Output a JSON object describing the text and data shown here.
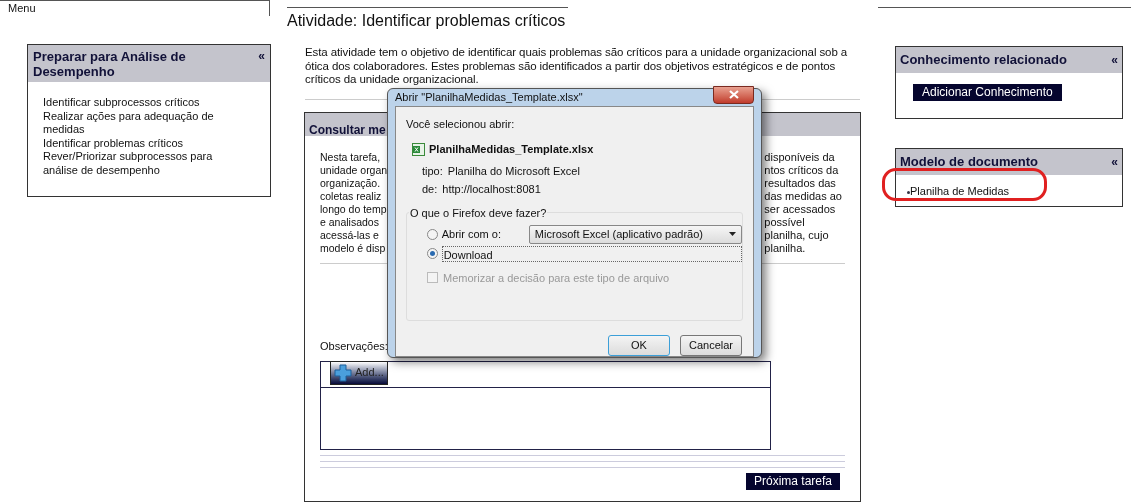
{
  "menu": {
    "label": "Menu"
  },
  "sidebar": {
    "title": "Preparar para Análise de Desempenho",
    "collapse": "«",
    "items": [
      "Identificar subprocessos críticos",
      "Realizar ações para adequação de medidas",
      "Identificar problemas críticos",
      "Rever/Priorizar subprocessos para análise de desempenho"
    ]
  },
  "activity": {
    "title": "Atividade: Identificar problemas críticos",
    "description": "Esta atividade tem o objetivo de identificar quais problemas são críticos para a unidade organizacional sob a ótica dos colaboradores. Estes problemas são identificados a partir dos objetivos estratégicos e de pontos críticos da unidade organizacional."
  },
  "task_panel": {
    "title": "Consultar me",
    "text_lines": [
      {
        "left": "Nesta tarefa,",
        "right": "disponíveis da"
      },
      {
        "left": "unidade organ",
        "right": "ntos críticos da"
      },
      {
        "left": "organização.",
        "right": "resultados das"
      },
      {
        "left": "coletas realiz",
        "right": "das medidas ao"
      },
      {
        "left": "longo do temp",
        "right": "ser acessados"
      },
      {
        "left": "e analisados",
        "right": "possível"
      },
      {
        "left": "acessá-las e",
        "right": "planilha, cujo"
      },
      {
        "left": "modelo é disp",
        "right": "planilha."
      }
    ],
    "observations_label": "Observações:",
    "add_button": "Add...",
    "next_button": "Próxima tarefa"
  },
  "related_knowledge": {
    "title": "Conhecimento relacionado",
    "collapse": "«",
    "button": "Adicionar Conhecimento"
  },
  "document_template": {
    "title": "Modelo de documento",
    "collapse": "«",
    "items": [
      {
        "label": "Planilha de Medidas",
        "highlighted": true
      }
    ]
  },
  "dialog": {
    "title": "Abrir \"PlanilhaMedidas_Template.xlsx\"",
    "intro": "Você selecionou abrir:",
    "filename": "PlanilhaMedidas_Template.xlsx",
    "type_label": "tipo:",
    "type_value": "Planilha do Microsoft Excel",
    "from_label": "de:",
    "from_value": "http://localhost:8081",
    "group_title": "O que o Firefox deve fazer?",
    "options": [
      {
        "label": "Abrir com o:",
        "selected": false,
        "app": "Microsoft Excel (aplicativo padrão)"
      },
      {
        "label": "Download",
        "selected": true
      }
    ],
    "remember": {
      "label": "Memorizar a decisão para este tipo de arquivo",
      "checked": false,
      "disabled": true
    },
    "buttons": [
      {
        "label": "OK",
        "default": true
      },
      {
        "label": "Cancelar",
        "default": false
      }
    ]
  }
}
